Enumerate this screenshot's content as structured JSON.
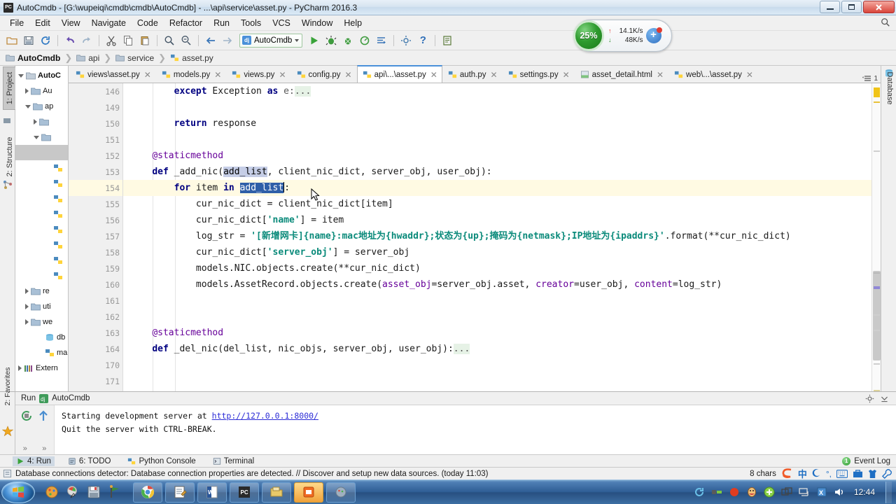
{
  "window": {
    "title": "AutoCmdb - [G:\\wupeiqi\\cmdb\\cmdb\\AutoCmdb] - ...\\api\\service\\asset.py - PyCharm 2016.3",
    "app_icon": "PC",
    "minimize_label": "Minimize",
    "maximize_label": "Restore",
    "close_label": "Close"
  },
  "menubar": {
    "items": [
      "File",
      "Edit",
      "View",
      "Navigate",
      "Code",
      "Refactor",
      "Run",
      "Tools",
      "VCS",
      "Window",
      "Help"
    ],
    "search_icon": "search-icon"
  },
  "toolbar": {
    "buttons": [
      "open-folder-icon",
      "save-all-icon",
      "sync-icon",
      "undo-icon",
      "redo-icon",
      "cut-icon",
      "copy-icon",
      "paste-icon",
      "find-icon",
      "replace-icon",
      "back-icon",
      "forward-icon"
    ],
    "run_config": "AutoCmdb",
    "run_config_icon": "django-icon",
    "right_buttons": [
      "run-icon",
      "debug-icon",
      "coverage-icon",
      "profile-icon",
      "attach-icon",
      "settings-icon",
      "help-icon",
      "db-console-icon"
    ]
  },
  "network_widget": {
    "percent": "25%",
    "up_arrow": "↑",
    "up_rate": "14.1K/s",
    "down_arrow": "↓",
    "down_rate": "48K/s",
    "plus_label": "+"
  },
  "breadcrumb": {
    "items": [
      {
        "label": "AutoCmdb",
        "icon": "folder-icon"
      },
      {
        "label": "api",
        "icon": "folder-icon"
      },
      {
        "label": "service",
        "icon": "folder-icon"
      },
      {
        "label": "asset.py",
        "icon": "python-file-icon"
      }
    ],
    "separator": "❯"
  },
  "left_rail": {
    "tabs": [
      {
        "label": "1: Project",
        "selected": true
      },
      {
        "label": "2: Structure",
        "selected": false
      }
    ]
  },
  "bottom_left_rail": {
    "tabs": [
      {
        "label": "2: Favorites",
        "selected": false
      }
    ]
  },
  "right_rail": {
    "tabs": [
      {
        "label": "Database",
        "selected": false
      }
    ]
  },
  "project_tree": {
    "rows": [
      {
        "indent": 0,
        "arrow": "open",
        "icon": "folder-icon",
        "label": "AutoC",
        "bold": true,
        "selected": false
      },
      {
        "indent": 1,
        "arrow": "closed",
        "icon": "folder-blue-icon",
        "label": "Au",
        "bold": false,
        "selected": false
      },
      {
        "indent": 1,
        "arrow": "open",
        "icon": "folder-blue-icon",
        "label": "ap",
        "bold": false,
        "selected": false
      },
      {
        "indent": 2,
        "arrow": "closed",
        "icon": "folder-blue-icon",
        "label": "",
        "bold": false,
        "selected": false
      },
      {
        "indent": 2,
        "arrow": "open",
        "icon": "folder-blue-icon",
        "label": "",
        "bold": false,
        "selected": false
      },
      {
        "indent": 3,
        "arrow": "none",
        "icon": "none",
        "label": "",
        "bold": false,
        "selected": true
      },
      {
        "indent": 3,
        "arrow": "none",
        "icon": "python-file-icon",
        "label": "",
        "bold": false,
        "selected": false
      },
      {
        "indent": 3,
        "arrow": "none",
        "icon": "python-file-icon",
        "label": "",
        "bold": false,
        "selected": false
      },
      {
        "indent": 3,
        "arrow": "none",
        "icon": "python-file-icon",
        "label": "",
        "bold": false,
        "selected": false
      },
      {
        "indent": 3,
        "arrow": "none",
        "icon": "python-file-icon",
        "label": "",
        "bold": false,
        "selected": false
      },
      {
        "indent": 3,
        "arrow": "none",
        "icon": "python-file-icon",
        "label": "",
        "bold": false,
        "selected": false
      },
      {
        "indent": 3,
        "arrow": "none",
        "icon": "python-file-icon",
        "label": "",
        "bold": false,
        "selected": false
      },
      {
        "indent": 3,
        "arrow": "none",
        "icon": "python-file-icon",
        "label": "",
        "bold": false,
        "selected": false
      },
      {
        "indent": 3,
        "arrow": "none",
        "icon": "python-file-icon",
        "label": "",
        "bold": false,
        "selected": false
      },
      {
        "indent": 1,
        "arrow": "closed",
        "icon": "folder-blue-icon",
        "label": "re",
        "bold": false,
        "selected": false
      },
      {
        "indent": 1,
        "arrow": "closed",
        "icon": "folder-blue-icon",
        "label": "uti",
        "bold": false,
        "selected": false
      },
      {
        "indent": 1,
        "arrow": "closed",
        "icon": "folder-blue-icon",
        "label": "we",
        "bold": false,
        "selected": false
      },
      {
        "indent": 2,
        "arrow": "none",
        "icon": "db-icon",
        "label": "db",
        "bold": false,
        "selected": false
      },
      {
        "indent": 2,
        "arrow": "none",
        "icon": "python-file-icon",
        "label": "ma",
        "bold": false,
        "selected": false
      },
      {
        "indent": 0,
        "arrow": "closed",
        "icon": "library-icon",
        "label": "Extern",
        "bold": false,
        "selected": false
      }
    ]
  },
  "editor_tabs": {
    "tabs": [
      {
        "label": "views\\asset.py",
        "icon": "python-file-icon",
        "active": false
      },
      {
        "label": "models.py",
        "icon": "python-file-icon",
        "active": false
      },
      {
        "label": "views.py",
        "icon": "python-file-icon",
        "active": false
      },
      {
        "label": "config.py",
        "icon": "python-file-icon",
        "active": false
      },
      {
        "label": "api\\...\\asset.py",
        "icon": "python-file-icon",
        "active": true
      },
      {
        "label": "auth.py",
        "icon": "python-file-icon",
        "active": false
      },
      {
        "label": "settings.py",
        "icon": "python-file-icon",
        "active": false
      },
      {
        "label": "asset_detail.html",
        "icon": "html-file-icon",
        "active": false
      },
      {
        "label": "web\\...\\asset.py",
        "icon": "python-file-icon",
        "active": false
      }
    ],
    "close_glyph": "✕",
    "overflow_count": "1"
  },
  "editor": {
    "lines": [
      {
        "num": "146",
        "fold": "plus",
        "highlight": false,
        "bulb": false,
        "tokens": [
          {
            "t": "        ",
            "c": "plain"
          },
          {
            "t": "except",
            "c": "kw"
          },
          {
            "t": " Exception ",
            "c": "plain"
          },
          {
            "t": "as",
            "c": "kw"
          },
          {
            "t": " e:",
            "c": "dim"
          },
          {
            "t": "...",
            "c": "dots"
          }
        ]
      },
      {
        "num": "149",
        "fold": "",
        "highlight": false,
        "bulb": false,
        "tokens": []
      },
      {
        "num": "150",
        "fold": "arm-end",
        "highlight": false,
        "bulb": false,
        "tokens": [
          {
            "t": "        ",
            "c": "plain"
          },
          {
            "t": "return",
            "c": "kw"
          },
          {
            "t": " response",
            "c": "plain"
          }
        ]
      },
      {
        "num": "151",
        "fold": "",
        "highlight": false,
        "bulb": false,
        "tokens": []
      },
      {
        "num": "152",
        "fold": "",
        "highlight": false,
        "bulb": false,
        "tokens": [
          {
            "t": "    ",
            "c": "plain"
          },
          {
            "t": "@staticmethod",
            "c": "kwarg"
          }
        ]
      },
      {
        "num": "153",
        "fold": "arm-start",
        "highlight": false,
        "bulb": false,
        "tokens": [
          {
            "t": "    ",
            "c": "plain"
          },
          {
            "t": "def",
            "c": "kw"
          },
          {
            "t": " _add_nic(",
            "c": "plain"
          },
          {
            "t": "add_list",
            "c": "sel-token"
          },
          {
            "t": ", client_nic_dict, server_obj, user_obj):",
            "c": "plain"
          }
        ]
      },
      {
        "num": "154",
        "fold": "arm-mid",
        "highlight": true,
        "bulb": true,
        "tokens": [
          {
            "t": "        ",
            "c": "plain"
          },
          {
            "t": "for",
            "c": "kw"
          },
          {
            "t": " item ",
            "c": "plain"
          },
          {
            "t": "in",
            "c": "kw"
          },
          {
            "t": " ",
            "c": "plain"
          },
          {
            "t": "add_list",
            "c": "sel-strong"
          },
          {
            "t": ":",
            "c": "plain"
          }
        ]
      },
      {
        "num": "155",
        "fold": "",
        "highlight": false,
        "bulb": false,
        "tokens": [
          {
            "t": "            cur_nic_dict = client_nic_dict[item]",
            "c": "plain"
          }
        ]
      },
      {
        "num": "156",
        "fold": "",
        "highlight": false,
        "bulb": false,
        "tokens": [
          {
            "t": "            cur_nic_dict[",
            "c": "plain"
          },
          {
            "t": "'name'",
            "c": "str"
          },
          {
            "t": "] = item",
            "c": "plain"
          }
        ]
      },
      {
        "num": "157",
        "fold": "",
        "highlight": false,
        "bulb": false,
        "tokens": [
          {
            "t": "            log_str = ",
            "c": "plain"
          },
          {
            "t": "'[新增网卡]{name}:mac地址为{hwaddr};状态为{up};掩码为{netmask};IP地址为{ipaddrs}'",
            "c": "str"
          },
          {
            "t": ".format(**cur_nic_dict)",
            "c": "plain"
          }
        ]
      },
      {
        "num": "158",
        "fold": "",
        "highlight": false,
        "bulb": false,
        "tokens": [
          {
            "t": "            cur_nic_dict[",
            "c": "plain"
          },
          {
            "t": "'server_obj'",
            "c": "str"
          },
          {
            "t": "] = server_obj",
            "c": "plain"
          }
        ]
      },
      {
        "num": "159",
        "fold": "",
        "highlight": false,
        "bulb": false,
        "tokens": [
          {
            "t": "            models.NIC.objects.create(**cur_nic_dict)",
            "c": "plain"
          }
        ]
      },
      {
        "num": "160",
        "fold": "arm-end",
        "highlight": false,
        "bulb": false,
        "tokens": [
          {
            "t": "            models.AssetRecord.objects.create(",
            "c": "plain"
          },
          {
            "t": "asset_obj",
            "c": "kwarg"
          },
          {
            "t": "=server_obj.asset, ",
            "c": "plain"
          },
          {
            "t": "creator",
            "c": "kwarg"
          },
          {
            "t": "=user_obj, ",
            "c": "plain"
          },
          {
            "t": "content",
            "c": "kwarg"
          },
          {
            "t": "=log_str)",
            "c": "plain"
          }
        ]
      },
      {
        "num": "161",
        "fold": "",
        "highlight": false,
        "bulb": false,
        "tokens": []
      },
      {
        "num": "162",
        "fold": "",
        "highlight": false,
        "bulb": false,
        "tokens": []
      },
      {
        "num": "163",
        "fold": "",
        "highlight": false,
        "bulb": false,
        "tokens": [
          {
            "t": "    ",
            "c": "plain"
          },
          {
            "t": "@staticmethod",
            "c": "kwarg"
          }
        ]
      },
      {
        "num": "164",
        "fold": "plus",
        "highlight": false,
        "bulb": false,
        "tokens": [
          {
            "t": "    ",
            "c": "plain"
          },
          {
            "t": "def",
            "c": "kw"
          },
          {
            "t": " _del_nic(del_list, nic_objs, server_obj, user_obj):",
            "c": "plain"
          },
          {
            "t": "...",
            "c": "dots"
          }
        ]
      },
      {
        "num": "170",
        "fold": "",
        "highlight": false,
        "bulb": false,
        "tokens": []
      },
      {
        "num": "171",
        "fold": "",
        "highlight": false,
        "bulb": false,
        "tokens": []
      }
    ]
  },
  "run_panel": {
    "title": "Run",
    "config_name": "AutoCmdb",
    "config_icon": "django-icon",
    "output": [
      {
        "pre": "Starting development server at ",
        "link": "http://127.0.0.1:8000/",
        "post": ""
      },
      {
        "pre": "Quit the server with CTRL-BREAK.",
        "link": "",
        "post": ""
      }
    ],
    "left_buttons": [
      "rerun-icon",
      "scroll-up-icon"
    ],
    "expand_glyph": "»",
    "right_buttons": [
      "settings-gear-icon",
      "pin-down-icon"
    ]
  },
  "bottom_tabs": {
    "tabs": [
      {
        "label": "4: Run",
        "icon": "run-icon",
        "selected": true
      },
      {
        "label": "6: TODO",
        "icon": "todo-icon",
        "selected": false
      },
      {
        "label": "Python Console",
        "icon": "python-console-icon",
        "selected": false
      },
      {
        "label": "Terminal",
        "icon": "terminal-icon",
        "selected": false
      }
    ],
    "event_log": "Event Log",
    "event_count": "1"
  },
  "status_bar": {
    "icon": "notification-icon",
    "message": "Database connections detector: Database connection properties are detected. // Discover and setup new data sources. (today 11:03)",
    "chars": "8 chars",
    "tray_icons": [
      "sogou-icon",
      "chinese-mode-icon",
      "moon-icon",
      "punct-icon",
      "keyboard-icon",
      "toolbox-icon",
      "shirt-icon",
      "wrench-icon"
    ]
  },
  "taskbar": {
    "start_label": "Start",
    "quick_launch": [
      "paint-icon",
      "color-picker-icon",
      "save-icon",
      "flag-icon"
    ],
    "tasks": [
      {
        "icon": "chrome-icon",
        "active": false
      },
      {
        "icon": "notepad-icon",
        "active": false
      },
      {
        "icon": "word-icon",
        "active": false
      },
      {
        "icon": "pycharm-icon",
        "active": false
      },
      {
        "icon": "explorer-icon",
        "active": false
      },
      {
        "icon": "orange-app-icon",
        "active": true
      },
      {
        "icon": "gray-app-icon",
        "active": false
      }
    ],
    "tray": [
      "sync-icon",
      "usb-icon",
      "red-circle-icon",
      "qq-icon",
      "shield-icon",
      "window-icon",
      "network-icon",
      "excel-icon",
      "volume-icon"
    ],
    "clock": "12:44",
    "show_desktop": "Show desktop"
  }
}
